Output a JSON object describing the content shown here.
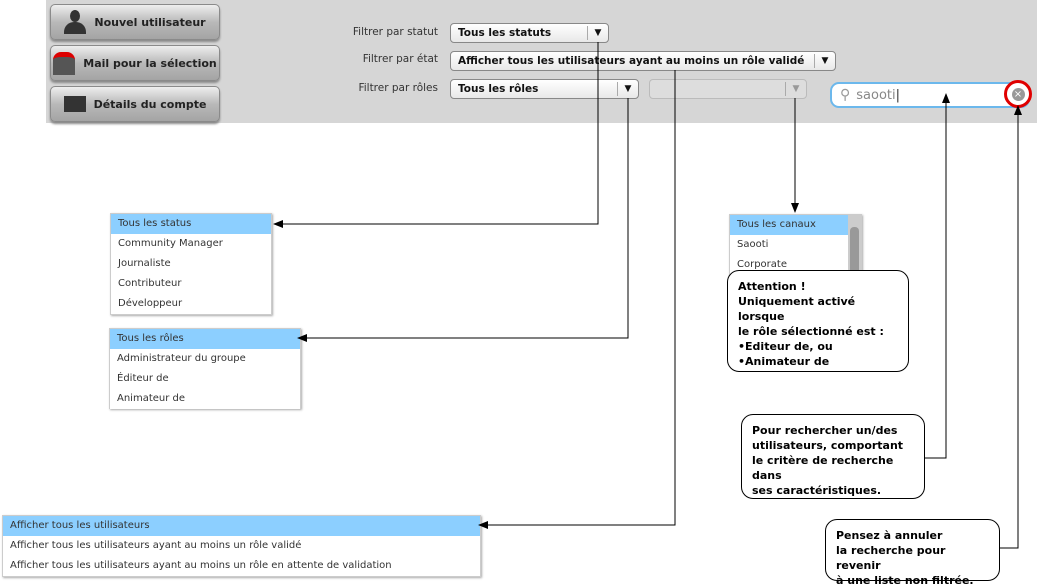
{
  "toolbar": {
    "new_user": "Nouvel utilisateur",
    "mail_selection": "Mail pour la sélection",
    "account_details": "Détails du compte"
  },
  "filters": {
    "status_label": "Filtrer par statut",
    "status_value": "Tous les statuts",
    "state_label": "Filtrer par état",
    "state_value": "Afficher tous les utilisateurs ayant au moins un rôle validé",
    "roles_label": "Filtrer par rôles",
    "roles_value": "Tous les rôles",
    "channel_value": ""
  },
  "search": {
    "value": "saooti"
  },
  "status_list": [
    "Tous les status",
    "Community Manager",
    "Journaliste",
    "Contributeur",
    "Développeur"
  ],
  "roles_list": [
    "Tous les rôles",
    "Administrateur du groupe",
    "Éditeur de",
    "Animateur de"
  ],
  "state_list": [
    "Afficher tous les utilisateurs",
    "Afficher tous les utilisateurs ayant au moins un rôle validé",
    "Afficher tous les utilisateurs ayant au moins un rôle en attente de validation"
  ],
  "channel_list": [
    "Tous les canaux",
    "Saooti",
    "Corporate"
  ],
  "callouts": {
    "attention": [
      "Attention !",
      "Uniquement activé lorsque",
      "le rôle sélectionné est :",
      "•Editeur de, ou",
      "•Animateur de"
    ],
    "search_help": [
      "Pour rechercher un/des",
      "utilisateurs, comportant",
      "le critère de recherche dans",
      "ses caractéristiques."
    ],
    "cancel_help": [
      "Pensez à annuler",
      "la recherche pour revenir",
      "à une liste non filtrée."
    ]
  },
  "colors": {
    "highlight": "#8ccfff",
    "search_border": "#6cb8ec",
    "clear_ring": "#e00000"
  }
}
